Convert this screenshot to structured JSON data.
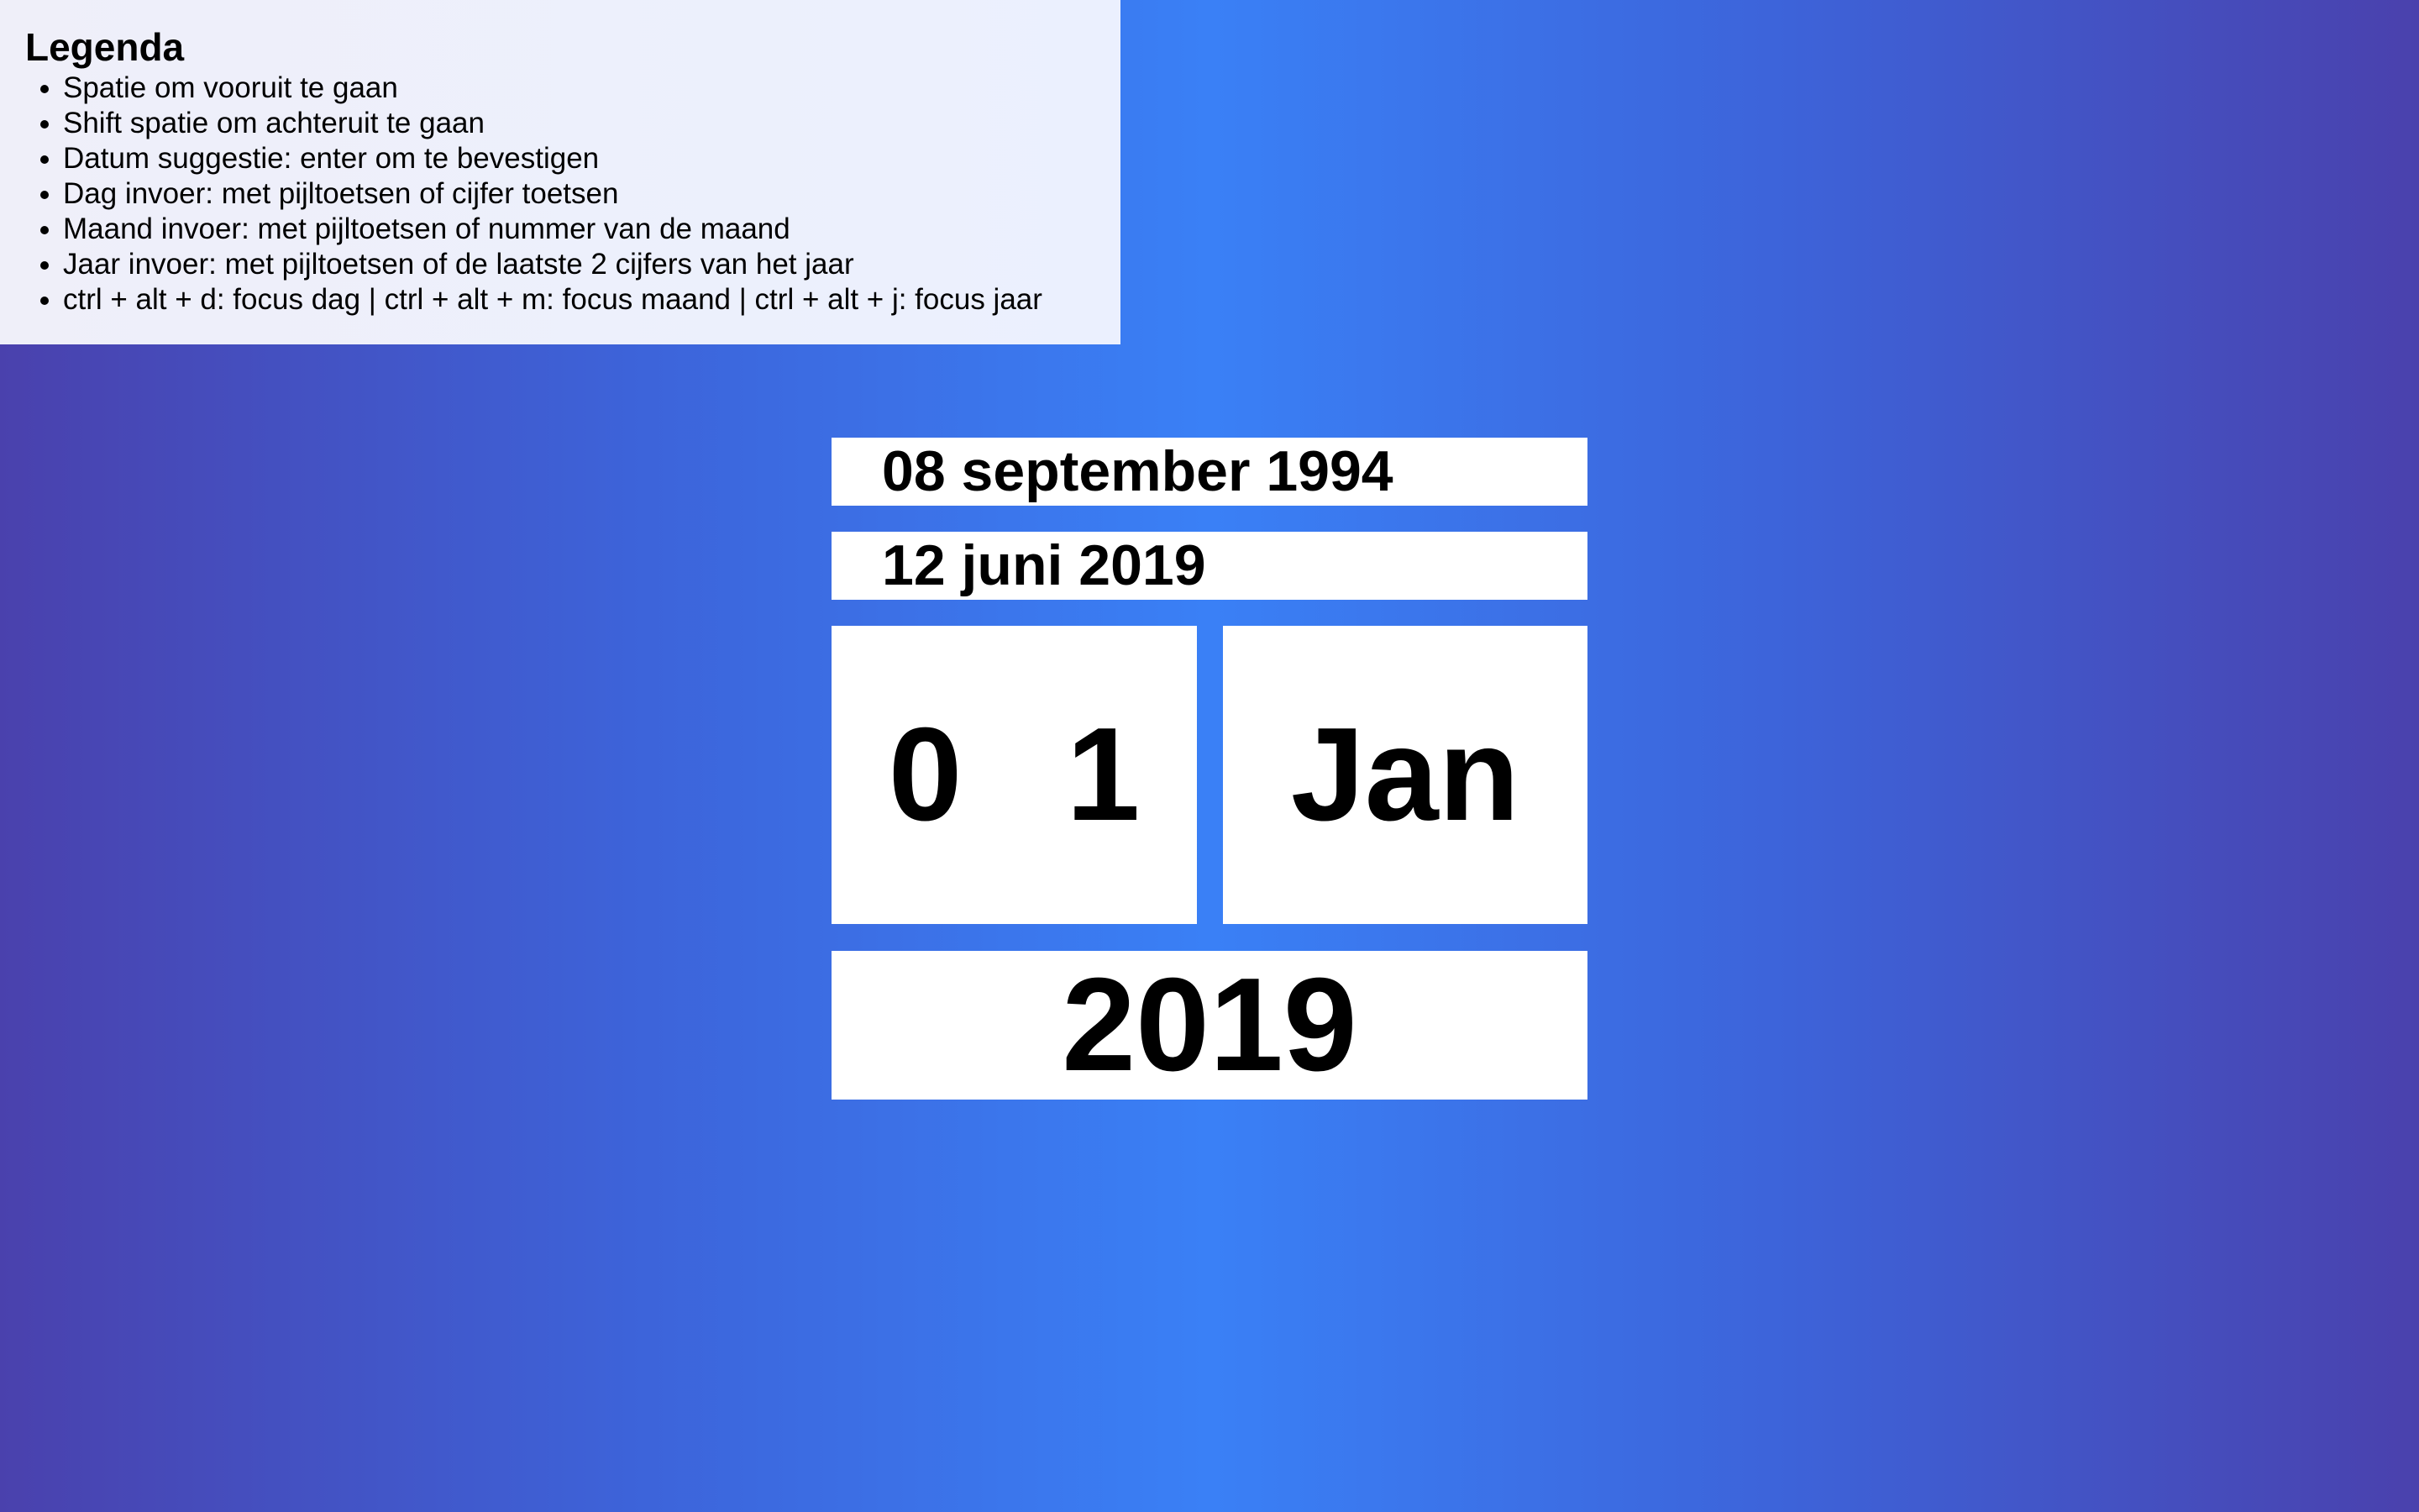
{
  "legend": {
    "title": "Legenda",
    "items": [
      "Spatie om vooruit te gaan",
      "Shift spatie om achteruit te gaan",
      "Datum suggestie: enter om te bevestigen",
      "Dag invoer: met pijltoetsen of cijfer toetsen",
      "Maand invoer: met pijltoetsen of nummer van de maand",
      "Jaar invoer: met pijltoetsen of de laatste 2 cijfers van het jaar",
      "ctrl + alt + d: focus dag | ctrl + alt + m: focus maand | ctrl + alt + j: focus jaar"
    ]
  },
  "suggestions": [
    "08 september 1994",
    "12 juni 2019"
  ],
  "date_input": {
    "day": "0 1",
    "month": "Jan",
    "year": "2019"
  },
  "colors": {
    "background_center": "#3a80f6",
    "background_edge": "#4a41ad",
    "panel": "#ffffff",
    "legend_background": "#eceffc"
  }
}
